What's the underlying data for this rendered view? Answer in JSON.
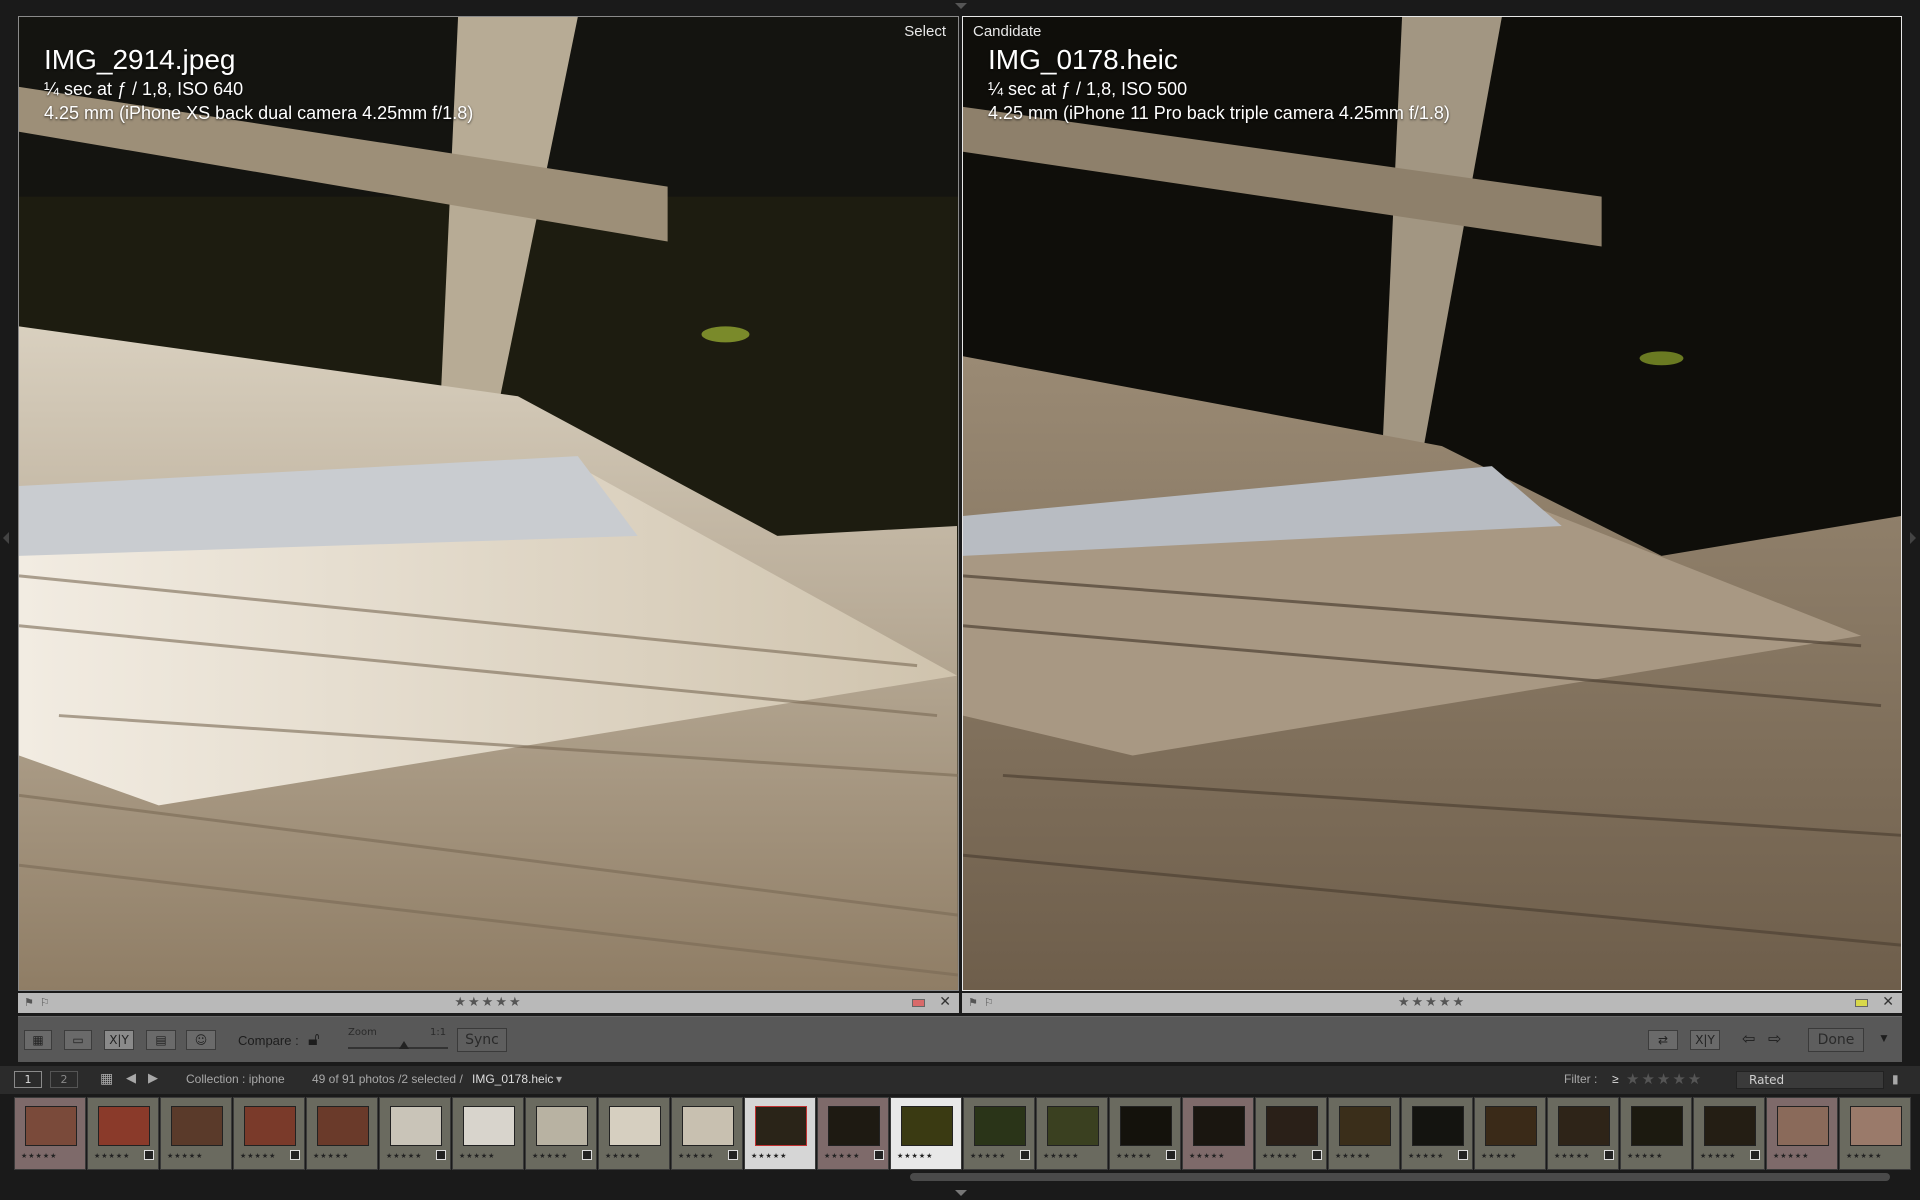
{
  "panes": [
    {
      "role": "Select",
      "filename": "IMG_2914.jpeg",
      "exposure": "¼ sec at ƒ / 1,8, ISO 640",
      "lens": "4.25 mm (iPhone XS back dual camera 4.25mm f/1.8)"
    },
    {
      "role": "Candidate",
      "filename": "IMG_0178.heic",
      "exposure": "¼ sec at ƒ / 1,8, ISO 500",
      "lens": "4.25 mm (iPhone 11 Pro back triple camera 4.25mm f/1.8)"
    }
  ],
  "rating_bars": [
    {
      "stars": "★★★★★",
      "color_label": "#d96a6a"
    },
    {
      "stars": "★★★★★",
      "color_label": "#d8d84a"
    }
  ],
  "toolbar": {
    "compare_label": "Compare :",
    "zoom_label": "Zoom",
    "zoom_max": "1:1",
    "sync_label": "Sync",
    "done_label": "Done",
    "icons": [
      "grid-view-icon",
      "loupe-view-icon",
      "compare-view-icon",
      "survey-view-icon",
      "people-view-icon",
      "lock-icon",
      "swap-icon",
      "make-select-icon",
      "prev-arrow-icon",
      "next-arrow-icon",
      "dropdown-icon"
    ]
  },
  "filmbar": {
    "screen1": "1",
    "screen2": "2",
    "collection": "Collection : iphone",
    "count": "49 of 91 photos /2 selected /",
    "current_file": "IMG_0178.heic",
    "filter_label": "Filter :",
    "filter_op": "≥",
    "filter_stars": "★★★★★",
    "filter_value": "Rated"
  },
  "filmstrip": {
    "thumb_count": 26,
    "selected_index": 10,
    "candidate_index": 12
  }
}
